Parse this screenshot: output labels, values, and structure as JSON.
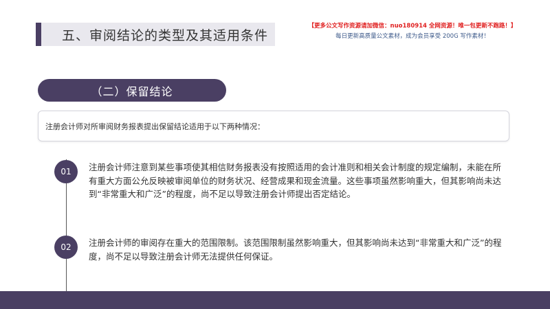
{
  "title": "五、审阅结论的类型及其适用条件",
  "promo": {
    "line1": "【更多公文写作资源请加微信：nuo180914  全网资源！唯一包更新不跑路！】",
    "line2": "每日更新高质量公文素材，成为会员享受 200G 写作素材！"
  },
  "section": {
    "label": "（二）保留结论"
  },
  "intro": "注册会计师对所审阅财务报表提出保留结论适用于以下两种情况：",
  "items": [
    {
      "number": "01",
      "text": "注册会计师注意到某些事项使其相信财务报表没有按照适用的会计准则和相关会计制度的规定编制，未能在所有重大方面公允反映被审阅单位的财务状况、经营成果和现金流量。这些事项虽然影响重大，但其影响尚未达到“非常重大和广泛”的程度，尚不足以导致注册会计师提出否定结论。"
    },
    {
      "number": "02",
      "text": "注册会计师的审阅存在重大的范围限制。该范围限制虽然影响重大，但其影响尚未达到“非常重大和广泛”的程度，尚不足以导致注册会计师无法提供任何保证。"
    }
  ],
  "colors": {
    "accent": "#4a3f63",
    "promo_red": "#e02020",
    "promo_blue": "#3d5a8a"
  }
}
